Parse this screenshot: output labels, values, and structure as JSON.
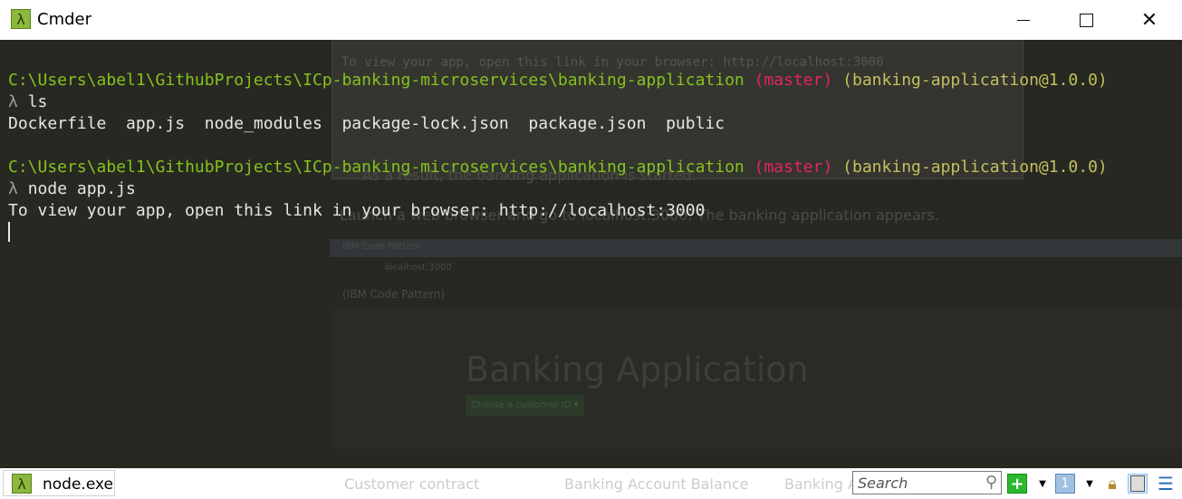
{
  "window": {
    "title": "Cmder",
    "app_icon": "lambda-icon",
    "controls": [
      "minimize",
      "maximize",
      "close"
    ]
  },
  "colors": {
    "path": "#86c21d",
    "branch": "#e6245e",
    "package": "#c2c05e",
    "text": "#e6e6e6",
    "background": "#272822"
  },
  "terminal": {
    "blocks": [
      {
        "path": "C:\\Users\\abel1\\GithubProjects\\ICp-banking-microservices\\banking-application",
        "branch": "(master)",
        "package": "(banking-application@1.0.0)",
        "prompt": "λ",
        "command": "ls",
        "output": "Dockerfile  app.js  node_modules  package-lock.json  package.json  public"
      },
      {
        "path": "C:\\Users\\abel1\\GithubProjects\\ICp-banking-microservices\\banking-application",
        "branch": "(master)",
        "package": "(banking-application@1.0.0)",
        "prompt": "λ",
        "command": "node app.js",
        "output": "To view your app, open this link in your browser: http://localhost:3000"
      }
    ]
  },
  "background_window": {
    "line1": "To view your app, open this link in your browser: http://localhost:3000",
    "line2": "As a result, the banking application is started.",
    "line3": "Launch a web browser and go to localhost:3000. The banking application appears.",
    "tab": "IBM Code Pattern",
    "address": "localhost:3000",
    "brand": "(IBM Code Pattern)",
    "heading": "Banking Application",
    "button": "Choose a customer ID ▾",
    "cols": [
      "Customer contract",
      "Banking Account Balance",
      "Banking A"
    ]
  },
  "statusbar": {
    "tab_label": "node.exe",
    "search_placeholder": "Search",
    "icons": [
      "search-icon",
      "new-console-icon",
      "dropdown-icon",
      "console-number-icon",
      "dropdown-icon",
      "lock-icon",
      "panel-icon",
      "menu-icon"
    ]
  }
}
